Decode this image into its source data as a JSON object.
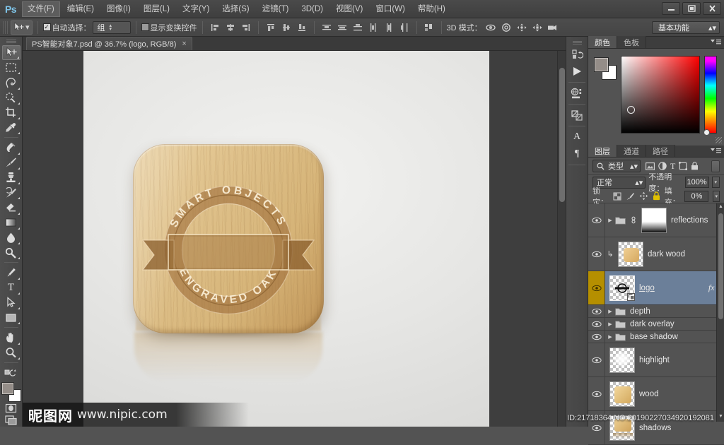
{
  "app": {
    "logo_text": "Ps",
    "window_buttons": {
      "minimize": "—",
      "maximize": "▢",
      "close": "✕"
    }
  },
  "menubar": {
    "items": [
      {
        "label": "文件(F)",
        "active": true
      },
      {
        "label": "编辑(E)",
        "active": false
      },
      {
        "label": "图像(I)",
        "active": false
      },
      {
        "label": "图层(L)",
        "active": false
      },
      {
        "label": "文字(Y)",
        "active": false
      },
      {
        "label": "选择(S)",
        "active": false
      },
      {
        "label": "滤镜(T)",
        "active": false
      },
      {
        "label": "3D(D)",
        "active": false
      },
      {
        "label": "视图(V)",
        "active": false
      },
      {
        "label": "窗口(W)",
        "active": false
      },
      {
        "label": "帮助(H)",
        "active": false
      }
    ]
  },
  "options_bar": {
    "tool_icon": "move-tool-icon",
    "auto_select_label": "自动选择：",
    "auto_select_checked": "✓",
    "auto_select_value": "组",
    "show_transform_label": "显示变换控件",
    "show_transform_checked": "",
    "mode_3d_label": "3D 模式：",
    "workspace": "基本功能",
    "align_icons": [
      "align-left-edges-icon",
      "align-horizontal-centers-icon",
      "align-right-edges-icon",
      "align-top-edges-icon",
      "align-vertical-centers-icon",
      "align-bottom-edges-icon"
    ],
    "distribute_icons": [
      "distribute-top-edges-icon",
      "distribute-vertical-centers-icon",
      "distribute-bottom-edges-icon",
      "distribute-left-edges-icon",
      "distribute-horizontal-centers-icon",
      "distribute-right-edges-icon"
    ],
    "mode_3d_icons": [
      "3d-orbit-icon",
      "3d-roll-icon",
      "3d-pan-icon",
      "3d-slide-icon",
      "3d-scale-icon"
    ]
  },
  "document_tab": {
    "title": "PS智能对象7.psd @ 36.7% (logo, RGB/8)",
    "close": "×"
  },
  "toolbar": {
    "tools": [
      {
        "name": "move-tool",
        "active": true
      },
      {
        "name": "rectangular-marquee-tool",
        "active": false
      },
      {
        "name": "lasso-tool",
        "active": false
      },
      {
        "name": "quick-selection-tool",
        "active": false
      },
      {
        "name": "crop-tool",
        "active": false
      },
      {
        "name": "eyedropper-tool",
        "active": false
      },
      {
        "name": "spot-healing-brush-tool",
        "active": false
      },
      {
        "name": "brush-tool",
        "active": false
      },
      {
        "name": "clone-stamp-tool",
        "active": false
      },
      {
        "name": "history-brush-tool",
        "active": false
      },
      {
        "name": "eraser-tool",
        "active": false
      },
      {
        "name": "gradient-tool",
        "active": false
      },
      {
        "name": "blur-tool",
        "active": false
      },
      {
        "name": "dodge-tool",
        "active": false
      },
      {
        "name": "pen-tool",
        "active": false
      },
      {
        "name": "type-tool",
        "active": false
      },
      {
        "name": "path-selection-tool",
        "active": false
      },
      {
        "name": "rectangle-tool",
        "active": false
      },
      {
        "name": "hand-tool",
        "active": false
      },
      {
        "name": "zoom-tool",
        "active": false
      }
    ],
    "type_tool_glyph": "T",
    "foreground_color": "#948d88",
    "background_color": "#ffffff",
    "quick_mask_icon": "quick-mask-icon",
    "screen_mode_icon": "screen-mode-icon"
  },
  "canvas": {
    "artwork": {
      "top_arc_text": "SMART OBJECTS",
      "bottom_arc_text": "ENGRAVED OAK",
      "wood_light": "#e8cf9f",
      "wood_dark": "#bb9055",
      "engrave_color": "#9c6f3c"
    },
    "zoom_level": "36.7%"
  },
  "mini_dock": {
    "buttons": [
      "history-panel-icon",
      "actions-play-icon",
      "3d-panel-icon",
      "adjustments-panel-icon",
      "character-panel-icon",
      "paragraph-panel-icon"
    ],
    "character_glyph": "A",
    "paragraph_glyph": "¶"
  },
  "color_panel": {
    "tabs": [
      {
        "label": "颜色",
        "selected": true
      },
      {
        "label": "色板",
        "selected": false
      }
    ],
    "foreground": "#948d88",
    "background": "#ffffff"
  },
  "layers_panel": {
    "tabs": [
      {
        "label": "图层",
        "selected": true
      },
      {
        "label": "通道",
        "selected": false
      },
      {
        "label": "路径",
        "selected": false
      }
    ],
    "filter_kind": "类型",
    "filter_icons": [
      "filter-pixel-icon",
      "filter-adjustment-icon",
      "filter-type-icon",
      "filter-shape-icon",
      "filter-smartobject-icon"
    ],
    "blend_mode": "正常",
    "opacity_label": "不透明度：",
    "opacity_value": "100%",
    "lock_label": "锁定：",
    "lock_icons": [
      "lock-transparent-pixels-icon",
      "lock-image-pixels-icon",
      "lock-position-icon",
      "lock-all-icon"
    ],
    "fill_label": "填充：",
    "fill_value": "0%",
    "layers": [
      {
        "name": "reflections",
        "type": "group",
        "visible": true,
        "selected": false,
        "expanded": false,
        "thumb": "gradient",
        "fx": false,
        "clipped": false,
        "linked": true
      },
      {
        "name": "dark wood",
        "type": "layer",
        "visible": true,
        "selected": false,
        "thumb": "wood",
        "fx": false,
        "clipped": true
      },
      {
        "name": "logo",
        "type": "smart-object",
        "visible": true,
        "selected": true,
        "thumb": "logo",
        "fx": true,
        "fx_label": "fx",
        "clipped": false
      },
      {
        "name": "depth",
        "type": "group",
        "visible": true,
        "selected": false,
        "expanded": false
      },
      {
        "name": "dark overlay",
        "type": "group",
        "visible": true,
        "selected": false,
        "expanded": false
      },
      {
        "name": "base shadow",
        "type": "group",
        "visible": true,
        "selected": false,
        "expanded": false
      },
      {
        "name": "highlight",
        "type": "layer",
        "visible": true,
        "selected": false,
        "thumb": "glow"
      },
      {
        "name": "wood",
        "type": "layer",
        "visible": true,
        "selected": false,
        "thumb": "wood"
      },
      {
        "name": "shadows",
        "type": "layer",
        "visible": true,
        "selected": false,
        "thumb": "wood"
      }
    ]
  },
  "watermark": {
    "cn": "昵图网",
    "url": "www.nipic.com",
    "id_line": "ID:21718364 NO:20190227034920192081"
  }
}
